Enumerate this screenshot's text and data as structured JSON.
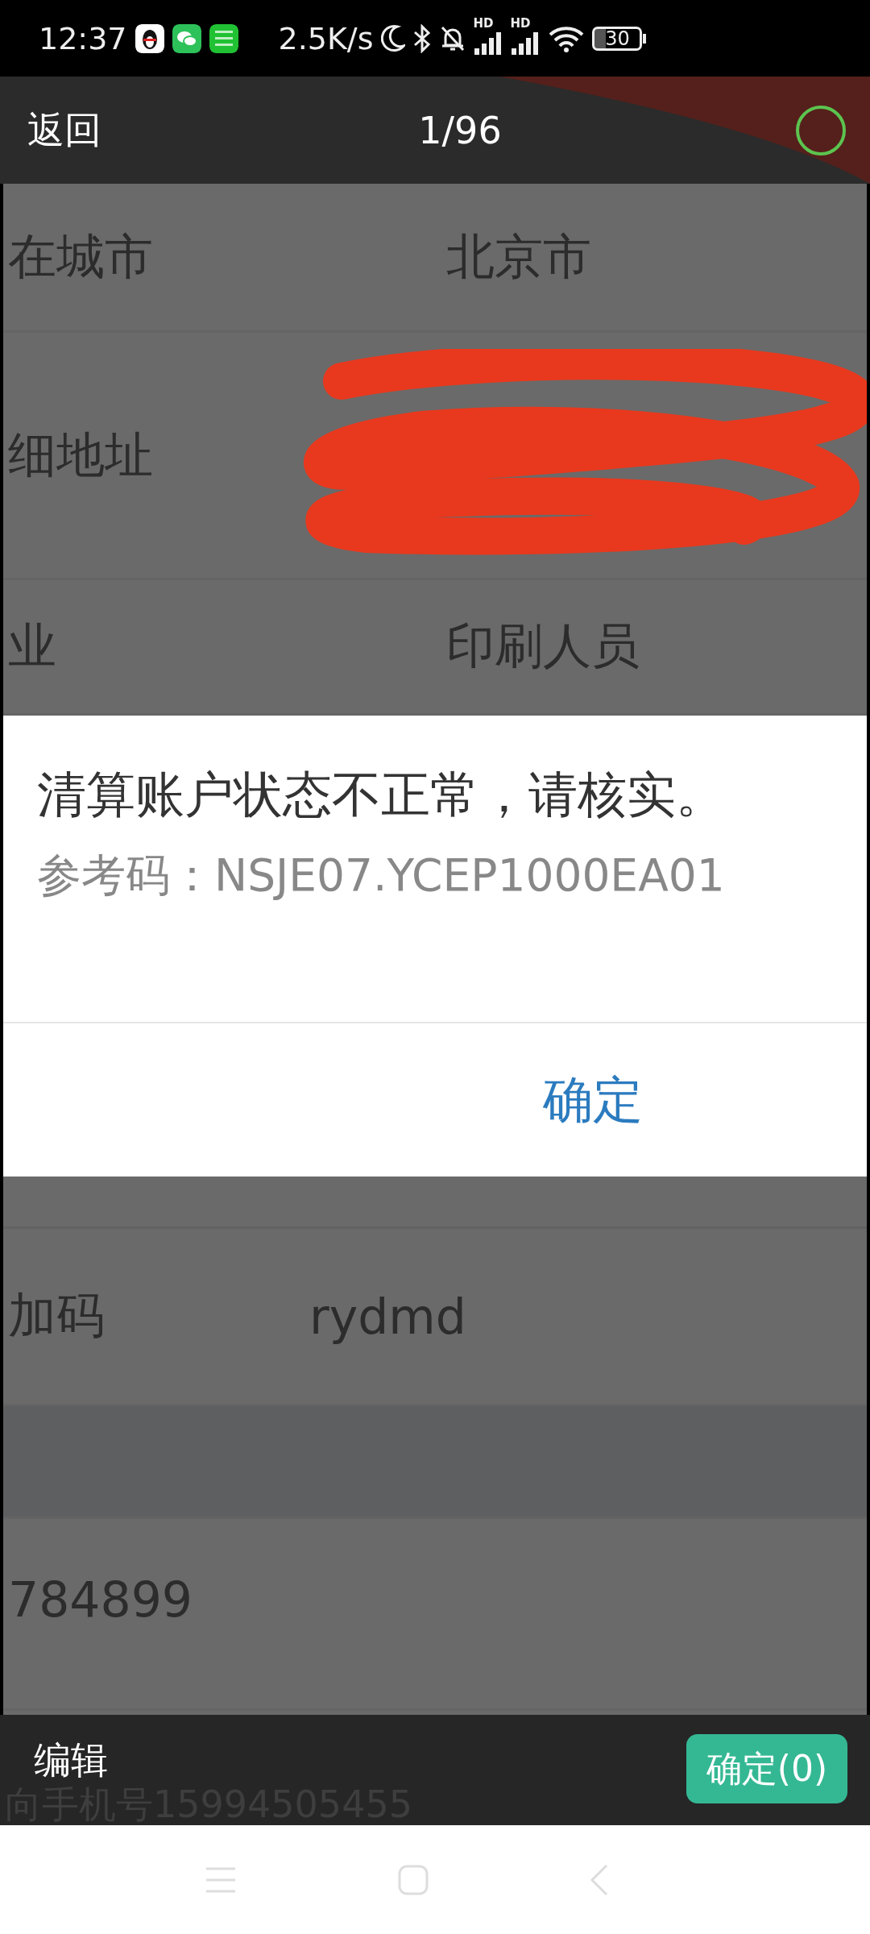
{
  "status_bar": {
    "time": "12:37",
    "net_speed": "2.5K/s",
    "signal_labels": [
      "HD",
      "HD"
    ],
    "battery": "30"
  },
  "header": {
    "back": "返回",
    "counter": "1/96",
    "select_ring": {
      "selected": false
    }
  },
  "rows": [
    {
      "kind": "field",
      "label": "在城市",
      "value": "北京市"
    },
    {
      "kind": "redacted",
      "label": "细地址"
    },
    {
      "kind": "field",
      "label": "业",
      "value": "印刷人员"
    },
    {
      "kind": "gap"
    },
    {
      "kind": "field",
      "label": "加码",
      "value": "rydmd"
    },
    {
      "kind": "band"
    },
    {
      "kind": "text",
      "label": "784899"
    }
  ],
  "dialog": {
    "message": "清算账户状态不正常，请核实。",
    "reference": "参考码：NSJE07.YCEP1000EA01",
    "button": "确定"
  },
  "footer": {
    "edit": "编辑",
    "confirm": "确定(0)",
    "behind_text": "向手机号15994505455"
  }
}
